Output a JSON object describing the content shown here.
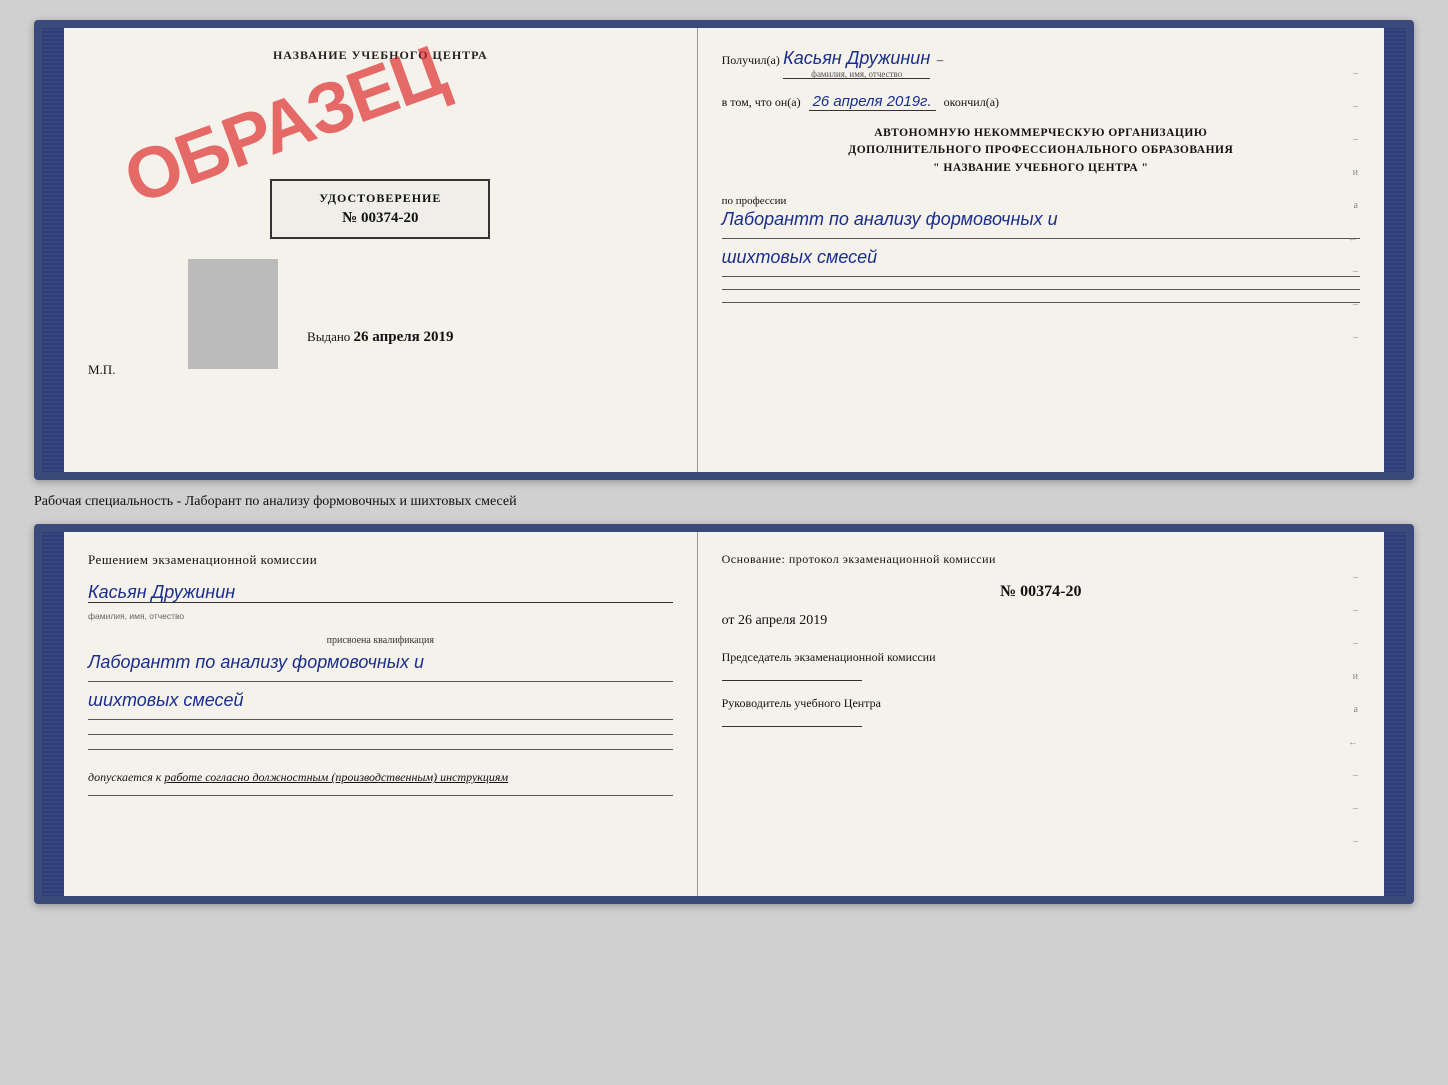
{
  "top_panel": {
    "left": {
      "cert_title": "НАЗВАНИЕ УЧЕБНОГО ЦЕНТРА",
      "stamp": "ОБРАЗЕЦ",
      "udostoverenie_label": "УДОСТОВЕРЕНИЕ",
      "number": "№ 00374-20",
      "vydano_label": "Выдано",
      "vydano_date": "26 апреля 2019",
      "mp_label": "М.П."
    },
    "right": {
      "poluchil_label": "Получил(а)",
      "poluchil_name": "Касьян Дружинин",
      "fio_sub": "фамилия, имя, отчество",
      "vtom_label": "в том, что он(а)",
      "vtom_date": "26 апреля 2019г.",
      "okonchil_label": "окончил(а)",
      "org_line1": "АВТОНОМНУЮ НЕКОММЕРЧЕСКУЮ ОРГАНИЗАЦИЮ",
      "org_line2": "ДОПОЛНИТЕЛЬНОГО ПРОФЕССИОНАЛЬНОГО ОБРАЗОВАНИЯ",
      "org_name": "\" НАЗВАНИЕ УЧЕБНОГО ЦЕНТРА \"",
      "prof_label": "по профессии",
      "prof_name": "Лаборантт по анализу формовочных и",
      "prof_name2": "шихтовых смесей"
    }
  },
  "middle_text": "Рабочая специальность - Лаборант по анализу формовочных и шихтовых смесей",
  "bottom_panel": {
    "left": {
      "resheniem_label": "Решением экзаменационной комиссии",
      "name": "Касьян Дружинин",
      "name_sub": "фамилия, имя, отчество",
      "prisvoena_label": "присвоена квалификация",
      "kvalif": "Лаборантт по анализу формовочных и",
      "kvalif2": "шихтовых смесей",
      "dopuskaetsya_label": "допускается к",
      "dopuskaetsya_text": "работе согласно должностным (производственным) инструкциям"
    },
    "right": {
      "osnovanie_label": "Основание: протокол экзаменационной комиссии",
      "protocol_num": "№ 00374-20",
      "protocol_ot": "от",
      "protocol_date": "26 апреля 2019",
      "chairman_label": "Председатель экзаменационной комиссии",
      "ruk_label": "Руководитель учебного Центра"
    }
  },
  "deco_right": {
    "lines": [
      "–",
      "–",
      "–",
      "и",
      "а",
      "←",
      "–",
      "–",
      "–"
    ]
  }
}
